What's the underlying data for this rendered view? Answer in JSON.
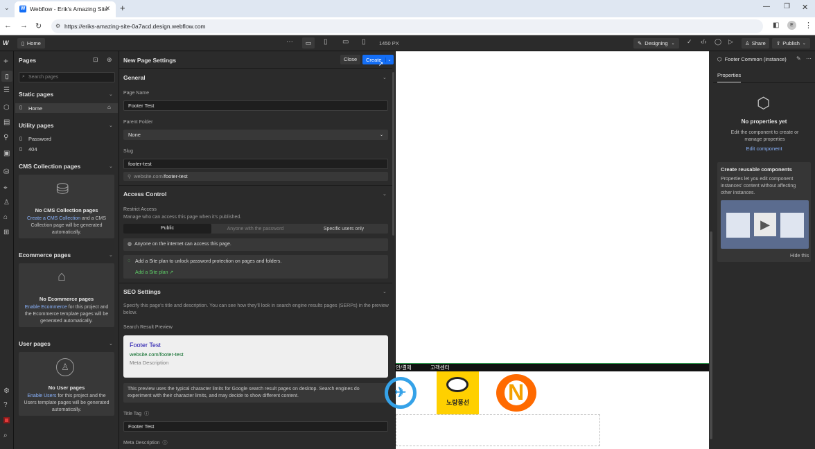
{
  "browser": {
    "tab_title": "Webflow - Erik's Amazing Site",
    "url": "https://eriks-amazing-site-0a7acd.design.webflow.com"
  },
  "topbar": {
    "breadcrumb": "Home",
    "width_label": "1450 PX",
    "mode": "Designing",
    "share": "Share",
    "publish": "Publish"
  },
  "pages_panel": {
    "title": "Pages",
    "search_placeholder": "Search pages",
    "static": {
      "title": "Static pages",
      "items": [
        "Home"
      ]
    },
    "utility": {
      "title": "Utility pages",
      "items": [
        "Password",
        "404"
      ]
    },
    "cms": {
      "title": "CMS Collection pages",
      "empty_title": "No CMS Collection pages",
      "link": "Create a CMS Collection",
      "text": " and a CMS Collection page will be generated automatically."
    },
    "ecommerce": {
      "title": "Ecommerce pages",
      "empty_title": "No Ecommerce pages",
      "link": "Enable Ecommerce",
      "text": " for this project and the Ecommerce template pages will be generated automatically."
    },
    "user": {
      "title": "User pages",
      "empty_title": "No User pages",
      "link": "Enable Users",
      "text": " for this project and the Users template pages will be generated automatically."
    }
  },
  "settings": {
    "title": "New Page Settings",
    "close": "Close",
    "create": "Create",
    "general": {
      "title": "General",
      "page_name_label": "Page Name",
      "page_name": "Footer Test",
      "parent_label": "Parent Folder",
      "parent": "None",
      "slug_label": "Slug",
      "slug": "footer-test",
      "url_prefix": "website.com/",
      "url_slug": "footer-test"
    },
    "access": {
      "title": "Access Control",
      "restrict_label": "Restrict Access",
      "restrict_desc": "Manage who can access this page when it's published.",
      "options": [
        "Public",
        "Anyone with the password",
        "Specific users only"
      ],
      "public_note": "Anyone on the internet can access this page.",
      "plan_note": "Add a Site plan to unlock password protection on pages and folders.",
      "plan_link": "Add a Site plan ↗"
    },
    "seo": {
      "title": "SEO Settings",
      "desc": "Specify this page's title and description. You can see how they'll look in search engine results pages (SERPs) in the preview below.",
      "preview_label": "Search Result Preview",
      "preview_title": "Footer Test",
      "preview_url": "website.com/footer-test",
      "preview_meta": "Meta Description",
      "note": "This preview uses the typical character limits for Google search result pages on desktop. Search engines do experiment with their character limits, and may decide to show different content.",
      "title_tag_label": "Title Tag",
      "title_tag": "Footer Test",
      "meta_label": "Meta Description"
    }
  },
  "canvas": {
    "nav_items": [
      "안/결제",
      "고객센터"
    ],
    "logo_text": "노랑풍선"
  },
  "right_panel": {
    "component": "Footer Common (instance)",
    "tab": "Properties",
    "empty_title": "No properties yet",
    "empty_text": "Edit the component to create or manage properties",
    "edit_link": "Edit component",
    "reuse_title": "Create reusable components",
    "reuse_text": "Properties let you edit component instances' content without affecting other instances.",
    "hide": "Hide this"
  },
  "colors": {
    "accent": "#146ef5",
    "dark": "#2b2b2b",
    "canvas_black": "#111111",
    "yellow": "#ffd000",
    "orange": "#ff6a00"
  }
}
